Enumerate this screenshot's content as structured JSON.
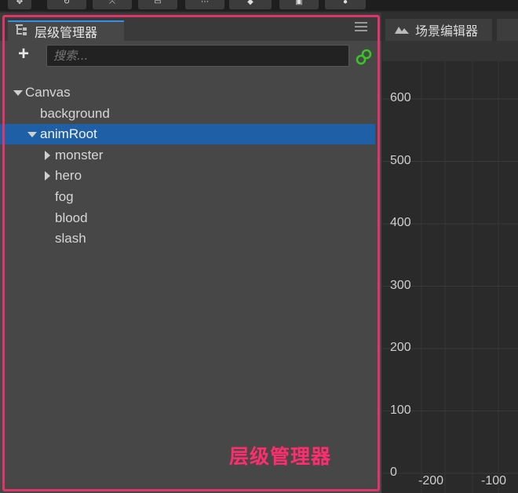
{
  "toolbar": {
    "buttons": [
      {
        "icon": "move-icon",
        "glyph": "✥"
      },
      {
        "icon": "rotate-icon",
        "glyph": "↻"
      },
      {
        "icon": "scale-icon",
        "glyph": "⤧"
      },
      {
        "icon": "rect-icon",
        "glyph": "▭"
      },
      {
        "icon": "dots-icon",
        "glyph": "⋯"
      },
      {
        "icon": "anchor-icon",
        "glyph": "◆"
      },
      {
        "icon": "box-icon",
        "glyph": "▣"
      },
      {
        "icon": "record-icon",
        "glyph": "●"
      }
    ]
  },
  "hierarchy": {
    "tab_title": "层级管理器",
    "search_placeholder": "搜索...",
    "add_label": "+",
    "tree": [
      {
        "label": "Canvas",
        "level": 0,
        "expander": "expanded",
        "selected": false
      },
      {
        "label": "background",
        "level": 1,
        "expander": "none",
        "selected": false
      },
      {
        "label": "animRoot",
        "level": 1,
        "expander": "expanded",
        "selected": true
      },
      {
        "label": "monster",
        "level": 2,
        "expander": "collapsed",
        "selected": false
      },
      {
        "label": "hero",
        "level": 2,
        "expander": "collapsed",
        "selected": false
      },
      {
        "label": "fog",
        "level": 2,
        "expander": "none",
        "selected": false
      },
      {
        "label": "blood",
        "level": 2,
        "expander": "none",
        "selected": false
      },
      {
        "label": "slash",
        "level": 2,
        "expander": "none",
        "selected": false
      }
    ]
  },
  "annotation": {
    "label": "层级管理器",
    "color": "#ff2d6f"
  },
  "scene_editor": {
    "tab_title": "场景编辑器",
    "y_ticks": [
      "600",
      "500",
      "400",
      "300",
      "200",
      "100",
      "0"
    ],
    "x_ticks": [
      "-200",
      "-100"
    ]
  },
  "colors": {
    "panel_bg": "#474747",
    "selection": "#1f5fa5",
    "tab_accent": "#3a8ee6",
    "link_icon": "#39c427"
  }
}
